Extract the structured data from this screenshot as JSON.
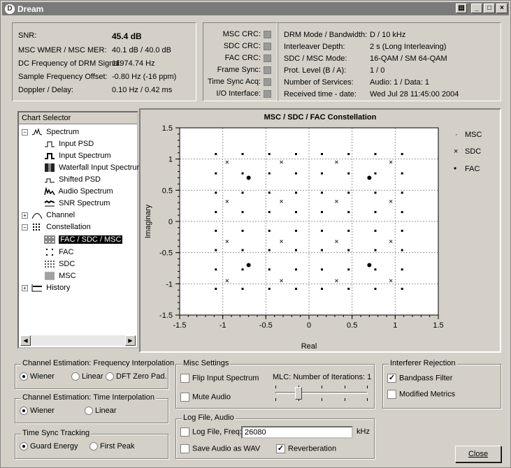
{
  "window": {
    "title": "Dream",
    "buttons": [
      "print",
      "minimize",
      "maximize",
      "close"
    ]
  },
  "status": {
    "rows": [
      {
        "label": "SNR:",
        "value": "45.4 dB"
      },
      {
        "label": "MSC WMER / MSC MER:",
        "value": "40.1 dB / 40.0 dB"
      },
      {
        "label": "DC Frequency of DRM Signal:",
        "value": "11974.74 Hz"
      },
      {
        "label": "Sample Frequency Offset:",
        "value": "-0.80 Hz (-16 ppm)"
      },
      {
        "label": "Doppler / Delay:",
        "value": "0.10 Hz / 0.42 ms"
      }
    ]
  },
  "crc": {
    "items": [
      {
        "label": "MSC CRC:"
      },
      {
        "label": "SDC CRC:"
      },
      {
        "label": "FAC CRC:"
      },
      {
        "label": "Frame Sync:"
      },
      {
        "label": "Time Sync Acq:"
      },
      {
        "label": "I/O Interface:"
      }
    ],
    "led_color": "#9a9a9a"
  },
  "drm": {
    "rows": [
      {
        "label": "DRM Mode / Bandwidth:",
        "value": "D / 10 kHz"
      },
      {
        "label": "Interleaver Depth:",
        "value": "2 s (Long Interleaving)"
      },
      {
        "label": "SDC / MSC Mode:",
        "value": "16-QAM / SM 64-QAM"
      },
      {
        "label": "Prot. Level (B / A):",
        "value": "1 / 0"
      },
      {
        "label": "Number of Services:",
        "value": "Audio: 1 / Data: 1"
      },
      {
        "label": "Received time - date:",
        "value": "Wed Jul 28 11:45:00 2004"
      }
    ]
  },
  "chart_selector": {
    "header": "Chart Selector",
    "items": [
      {
        "label": "Spectrum",
        "icon": "spectrum-icon"
      },
      {
        "label": "Input PSD",
        "icon": "psd-icon"
      },
      {
        "label": "Input Spectrum",
        "icon": "input-spectrum-icon"
      },
      {
        "label": "Waterfall Input Spectrur",
        "icon": "waterfall-icon"
      },
      {
        "label": "Shifted PSD",
        "icon": "shifted-psd-icon"
      },
      {
        "label": "Audio Spectrum",
        "icon": "audio-spectrum-icon"
      },
      {
        "label": "SNR Spectrum",
        "icon": "snr-spectrum-icon"
      },
      {
        "label": "Channel",
        "icon": "channel-icon"
      },
      {
        "label": "Constellation",
        "icon": "constellation-icon"
      },
      {
        "label": "FAC / SDC / MSC",
        "icon": "fac-sdc-msc-icon"
      },
      {
        "label": "FAC",
        "icon": "fac-icon"
      },
      {
        "label": "SDC",
        "icon": "sdc-icon"
      },
      {
        "label": "MSC",
        "icon": "msc-icon"
      },
      {
        "label": "History",
        "icon": "history-icon"
      }
    ]
  },
  "plot": {
    "title": "MSC / SDC / FAC Constellation",
    "xlabel": "Real",
    "ylabel": "Imaginary",
    "xticks": [
      "-1.5",
      "-1",
      "-0.5",
      "0",
      "0.5",
      "1",
      "1.5"
    ],
    "yticks": [
      "1.5",
      "1",
      "0.5",
      "0",
      "-0.5",
      "-1",
      "-1.5"
    ],
    "legend": [
      {
        "marker": "·",
        "label": "MSC"
      },
      {
        "marker": "×",
        "label": "SDC"
      },
      {
        "marker": "•",
        "label": "FAC"
      }
    ]
  },
  "chart_data": {
    "type": "scatter",
    "title": "MSC / SDC / FAC Constellation",
    "xlabel": "Real",
    "ylabel": "Imaginary",
    "xlim": [
      -1.5,
      1.5
    ],
    "ylim": [
      -1.5,
      1.5
    ],
    "grid": true,
    "legend_position": "right",
    "series": [
      {
        "name": "MSC",
        "marker": "dot",
        "levels": [
          -1.08,
          -0.77,
          -0.46,
          -0.15,
          0.15,
          0.46,
          0.77,
          1.08
        ]
      },
      {
        "name": "SDC",
        "marker": "cross",
        "levels": [
          -0.95,
          -0.32,
          0.32,
          0.95
        ]
      },
      {
        "name": "FAC",
        "marker": "disc",
        "points": [
          [
            -0.7,
            0.7
          ],
          [
            0.7,
            0.7
          ],
          [
            -0.7,
            -0.7
          ],
          [
            0.7,
            -0.7
          ]
        ]
      }
    ]
  },
  "freq_interp": {
    "title": "Channel Estimation: Frequency Interpolation",
    "options": [
      "Wiener",
      "Linear",
      "DFT Zero Pad."
    ],
    "selected": "Wiener"
  },
  "time_interp": {
    "title": "Channel Estimation: Time Interpolation",
    "options": [
      "Wiener",
      "Linear"
    ],
    "selected": "Wiener"
  },
  "time_sync": {
    "title": "Time Sync Tracking",
    "options": [
      "Guard Energy",
      "First Peak"
    ],
    "selected": "Guard Energy"
  },
  "misc": {
    "title": "Misc Settings",
    "flip_label": "Flip Input Spectrum",
    "flip_checked": false,
    "mute_label": "Mute Audio",
    "mute_checked": false,
    "mlc_label": "MLC: Number of Iterations: 1",
    "mlc_value": 1
  },
  "logfile": {
    "title": "Log File, Audio",
    "log_label": "Log File, Freq:",
    "log_checked": false,
    "freq_value": "26080",
    "unit": "kHz",
    "save_label": "Save Audio as WAV",
    "save_checked": false,
    "reverb_label": "Reverberation",
    "reverb_checked": true
  },
  "interferer": {
    "title": "Interferer Rejection",
    "bandpass_label": "Bandpass Filter",
    "bandpass_checked": true,
    "modified_label": "Modified Metrics",
    "modified_checked": false
  },
  "close_button": "Close"
}
